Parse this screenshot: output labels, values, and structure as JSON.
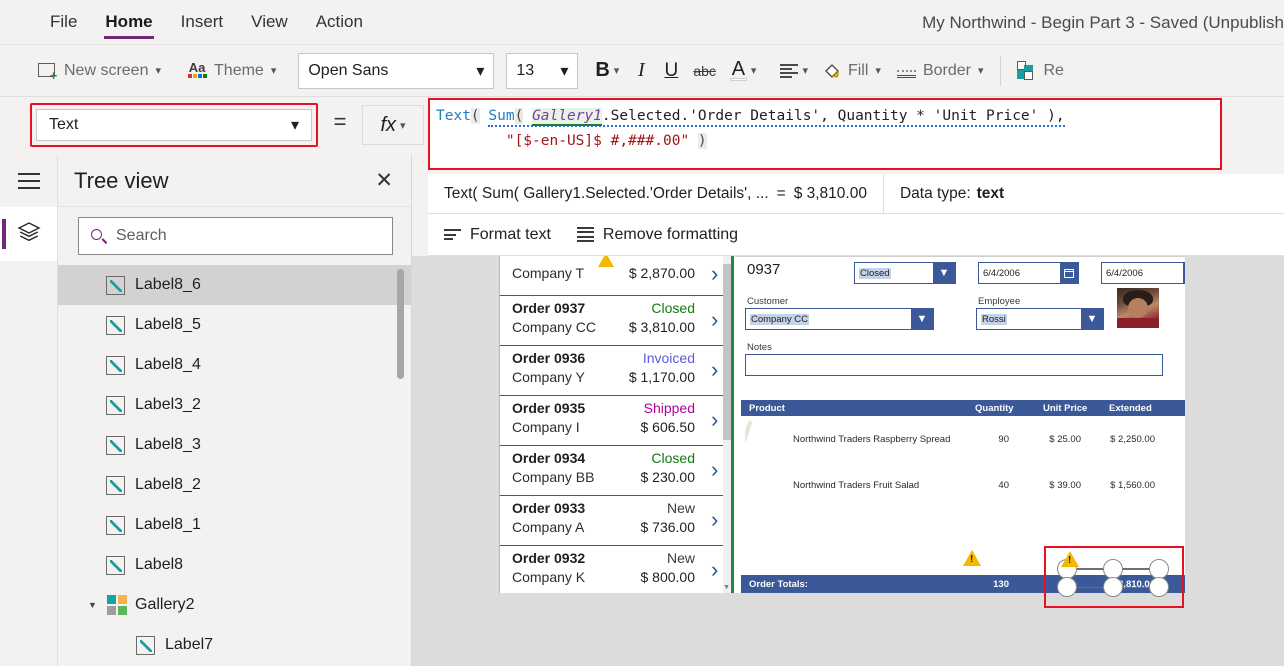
{
  "menu": {
    "items": [
      {
        "label": "File",
        "active": false
      },
      {
        "label": "Home",
        "active": true
      },
      {
        "label": "Insert",
        "active": false
      },
      {
        "label": "View",
        "active": false
      },
      {
        "label": "Action",
        "active": false
      }
    ],
    "app_title": "My Northwind - Begin Part 3 - Saved (Unpublish"
  },
  "toolbar": {
    "new_screen": "New screen",
    "theme": "Theme",
    "font_family": "Open Sans",
    "font_size": "13",
    "bold": "B",
    "italic": "I",
    "underline": "U",
    "strikethrough": "abc",
    "font_color": "A",
    "align": "align",
    "fill": "Fill",
    "border": "Border",
    "reorder": "Re"
  },
  "formula_bar": {
    "property": "Text",
    "equals": "=",
    "fx": "fx",
    "line1": {
      "fn": "Text",
      "open1": "(",
      "space1": " ",
      "fn2": "Sum",
      "open2": "(",
      "space2": " ",
      "obj": "Gallery1",
      "rest": ".Selected.'Order Details', Quantity * 'Unit Price' ),"
    },
    "line2": {
      "indent": "        ",
      "str": "\"[$-en-US]$ #,###.00\"",
      "space": " ",
      "close": ")"
    }
  },
  "result_bar": {
    "expression": "Text( Sum( Gallery1.Selected.'Order Details', ...",
    "equals": "=",
    "value": "$ 3,810.00",
    "data_type_label": "Data type:",
    "data_type_value": "text"
  },
  "action_bar": {
    "format_text": "Format text",
    "remove_formatting": "Remove formatting"
  },
  "tree_view": {
    "title": "Tree view",
    "close": "✕",
    "search_placeholder": "Search",
    "items": [
      {
        "label": "Label8_6",
        "type": "label",
        "selected": true,
        "child": false,
        "group": false
      },
      {
        "label": "Label8_5",
        "type": "label",
        "selected": false,
        "child": false,
        "group": false
      },
      {
        "label": "Label8_4",
        "type": "label",
        "selected": false,
        "child": false,
        "group": false
      },
      {
        "label": "Label3_2",
        "type": "label",
        "selected": false,
        "child": false,
        "group": false
      },
      {
        "label": "Label8_3",
        "type": "label",
        "selected": false,
        "child": false,
        "group": false
      },
      {
        "label": "Label8_2",
        "type": "label",
        "selected": false,
        "child": false,
        "group": false
      },
      {
        "label": "Label8_1",
        "type": "label",
        "selected": false,
        "child": false,
        "group": false
      },
      {
        "label": "Label8",
        "type": "label",
        "selected": false,
        "child": false,
        "group": false
      },
      {
        "label": "Gallery2",
        "type": "gallery",
        "selected": false,
        "child": false,
        "group": true
      },
      {
        "label": "Label7",
        "type": "label",
        "selected": false,
        "child": true,
        "group": false
      }
    ]
  },
  "canvas": {
    "gallery_rows": [
      {
        "order": "",
        "company": "Company T",
        "status": "",
        "amount": "$ 2,870.00",
        "status_color": "#107c10",
        "partial": true,
        "warning": true
      },
      {
        "order": "Order 0937",
        "company": "Company CC",
        "status": "Closed",
        "amount": "$ 3,810.00",
        "status_color": "#107c10",
        "partial": false,
        "warning": false
      },
      {
        "order": "Order 0936",
        "company": "Company Y",
        "status": "Invoiced",
        "amount": "$ 1,170.00",
        "status_color": "#5b5bd6",
        "partial": false,
        "warning": false
      },
      {
        "order": "Order 0935",
        "company": "Company I",
        "status": "Shipped",
        "amount": "$ 606.50",
        "status_color": "#b4009e",
        "partial": false,
        "warning": false
      },
      {
        "order": "Order 0934",
        "company": "Company BB",
        "status": "Closed",
        "amount": "$ 230.00",
        "status_color": "#107c10",
        "partial": false,
        "warning": false
      },
      {
        "order": "Order 0933",
        "company": "Company A",
        "status": "New",
        "amount": "$ 736.00",
        "status_color": "#3a3a3a",
        "partial": false,
        "warning": false
      },
      {
        "order": "Order 0932",
        "company": "Company K",
        "status": "New",
        "amount": "$ 800.00",
        "status_color": "#3a3a3a",
        "partial": false,
        "warning": false
      }
    ],
    "detail": {
      "order_number": "0937",
      "status": "Closed",
      "date1": "6/4/2006",
      "date2": "6/4/2006",
      "customer_label": "Customer",
      "customer_value": "Company CC",
      "employee_label": "Employee",
      "employee_value": "Rossi",
      "notes_label": "Notes",
      "notes_value": "",
      "table_headers": {
        "product": "Product",
        "quantity": "Quantity",
        "unit_price": "Unit Price",
        "extended": "Extended"
      },
      "table_rows": [
        {
          "product": "Northwind Traders Raspberry Spread",
          "quantity": "90",
          "unit_price": "$ 25.00",
          "extended": "$ 2,250.00",
          "image": "raspberry"
        },
        {
          "product": "Northwind Traders Fruit Salad",
          "quantity": "40",
          "unit_price": "$ 39.00",
          "extended": "$ 1,560.00",
          "image": "fruitsalad"
        }
      ],
      "totals_label": "Order Totals:",
      "totals_quantity": "130",
      "totals_extended": "$ 3,810.00"
    }
  },
  "colors": {
    "accent_purple": "#742774",
    "highlight_red": "#e81123",
    "form_blue": "#3b5998",
    "select_green": "#1e8b3a",
    "warning_yellow": "#f5b800"
  }
}
